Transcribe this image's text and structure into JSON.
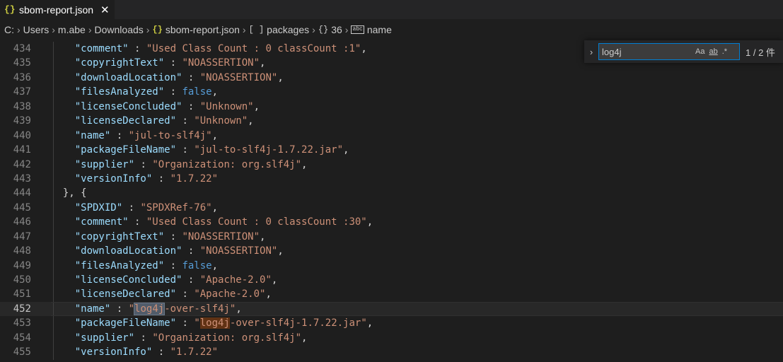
{
  "tab": {
    "label": "sbom-report.json",
    "icon": "{}",
    "close": "✕"
  },
  "breadcrumb": [
    {
      "label": "C:",
      "icon": ""
    },
    {
      "label": "Users",
      "icon": ""
    },
    {
      "label": "m.abe",
      "icon": ""
    },
    {
      "label": "Downloads",
      "icon": ""
    },
    {
      "label": "sbom-report.json",
      "icon": "{}"
    },
    {
      "label": "packages",
      "icon": "[ ]"
    },
    {
      "label": "36",
      "icon": "{}"
    },
    {
      "label": "name",
      "icon": "abc"
    }
  ],
  "find": {
    "toggle": "›",
    "query": "log4j",
    "match_case": "Aa",
    "whole_word": "ab",
    "regex": ".*",
    "count": "1 / 2 件"
  },
  "editor": {
    "current_line": 452,
    "lines": [
      {
        "n": 434,
        "code": "    \"comment\" : \"Used Class Count : 0 classCount :1\","
      },
      {
        "n": 435,
        "code": "    \"copyrightText\" : \"NOASSERTION\","
      },
      {
        "n": 436,
        "code": "    \"downloadLocation\" : \"NOASSERTION\","
      },
      {
        "n": 437,
        "code": "    \"filesAnalyzed\" : false,"
      },
      {
        "n": 438,
        "code": "    \"licenseConcluded\" : \"Unknown\","
      },
      {
        "n": 439,
        "code": "    \"licenseDeclared\" : \"Unknown\","
      },
      {
        "n": 440,
        "code": "    \"name\" : \"jul-to-slf4j\","
      },
      {
        "n": 441,
        "code": "    \"packageFileName\" : \"jul-to-slf4j-1.7.22.jar\","
      },
      {
        "n": 442,
        "code": "    \"supplier\" : \"Organization: org.slf4j\","
      },
      {
        "n": 443,
        "code": "    \"versionInfo\" : \"1.7.22\""
      },
      {
        "n": 444,
        "code": "  }, {"
      },
      {
        "n": 445,
        "code": "    \"SPDXID\" : \"SPDXRef-76\","
      },
      {
        "n": 446,
        "code": "    \"comment\" : \"Used Class Count : 0 classCount :30\","
      },
      {
        "n": 447,
        "code": "    \"copyrightText\" : \"NOASSERTION\","
      },
      {
        "n": 448,
        "code": "    \"downloadLocation\" : \"NOASSERTION\","
      },
      {
        "n": 449,
        "code": "    \"filesAnalyzed\" : false,"
      },
      {
        "n": 450,
        "code": "    \"licenseConcluded\" : \"Apache-2.0\","
      },
      {
        "n": 451,
        "code": "    \"licenseDeclared\" : \"Apache-2.0\","
      },
      {
        "n": 452,
        "code": "    \"name\" : \"log4j-over-slf4j\","
      },
      {
        "n": 453,
        "code": "    \"packageFileName\" : \"log4j-over-slf4j-1.7.22.jar\","
      },
      {
        "n": 454,
        "code": "    \"supplier\" : \"Organization: org.slf4j\","
      },
      {
        "n": 455,
        "code": "    \"versionInfo\" : \"1.7.22\""
      }
    ]
  },
  "colors": {
    "background": "#1e1e1e",
    "key": "#9cdcfe",
    "string": "#ce9178",
    "boolean": "#569cd6",
    "find_border": "#007fd4",
    "current_match": "#515c6a",
    "other_match": "#613214"
  }
}
